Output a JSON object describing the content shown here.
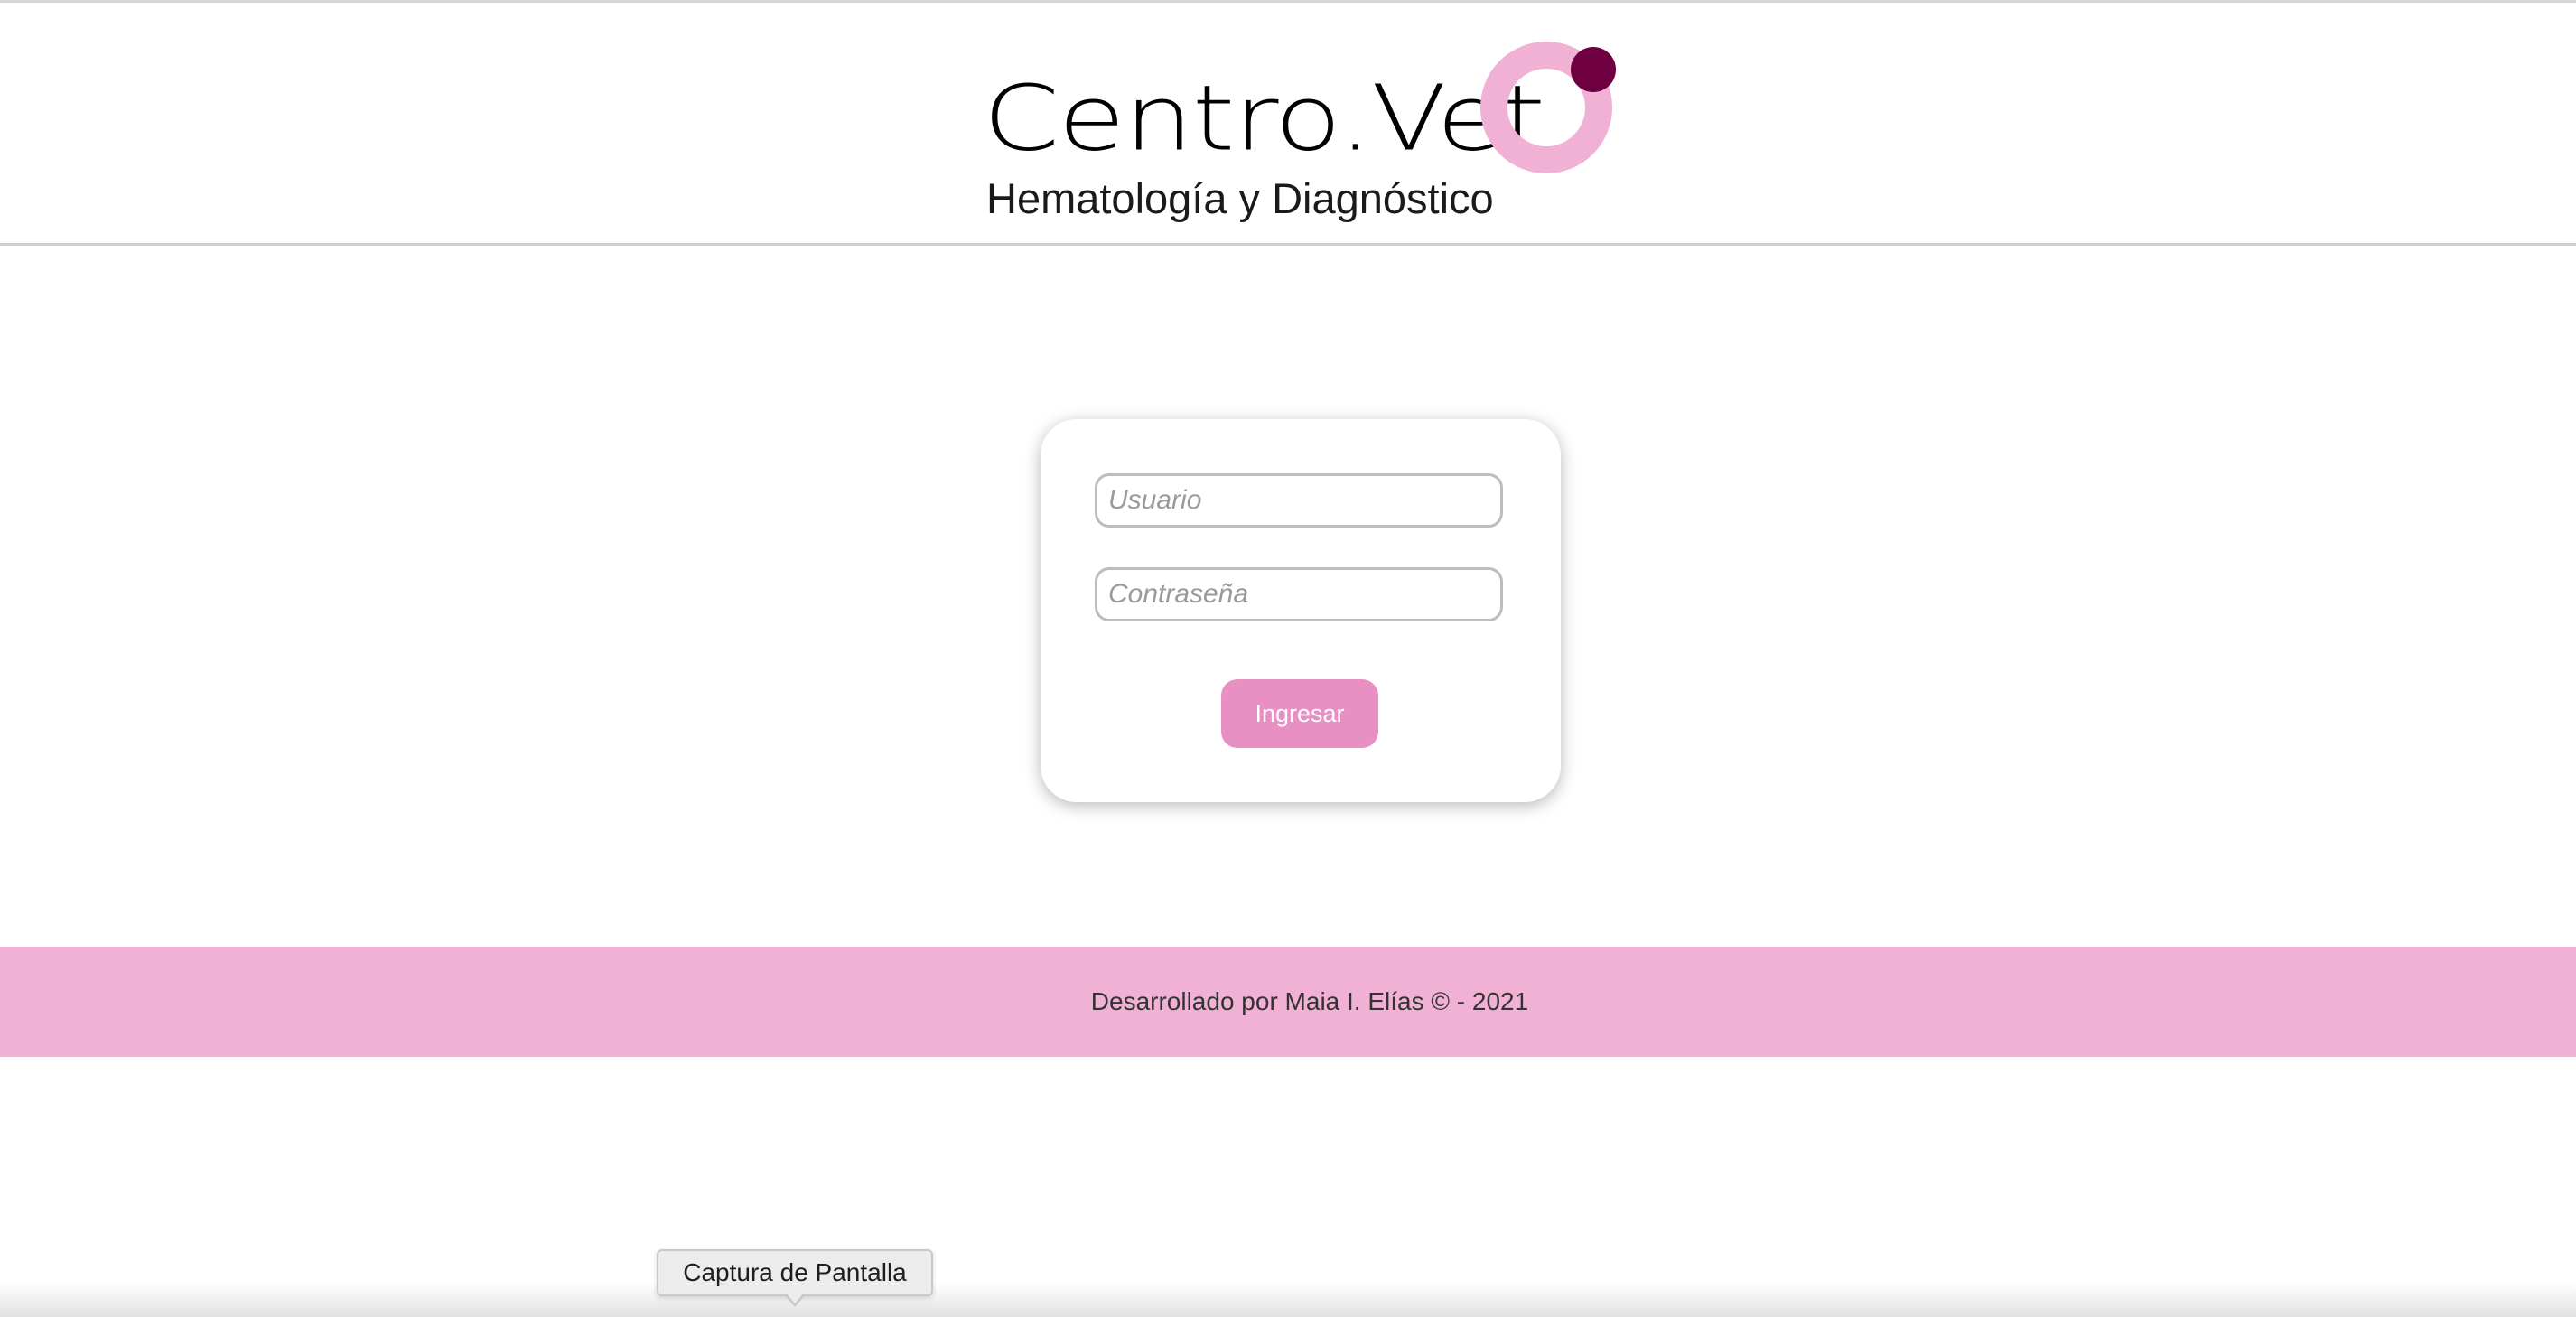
{
  "header": {
    "logo": {
      "title": "Centro.Vet",
      "subtitle": "Hematología y Diagnóstico",
      "ring_color": "#f0b1d4",
      "dot_color": "#6e0042"
    }
  },
  "login": {
    "username_placeholder": "Usuario",
    "password_placeholder": "Contraseña",
    "submit_label": "Ingresar"
  },
  "footer": {
    "text": "Desarrollado por Maia I. Elías © - 2021"
  },
  "tooltip": {
    "text": "Captura de Pantalla"
  },
  "colors": {
    "accent": "#e88fc3",
    "footer_bg": "#f0b1d4",
    "brand_dark": "#6e0042"
  }
}
